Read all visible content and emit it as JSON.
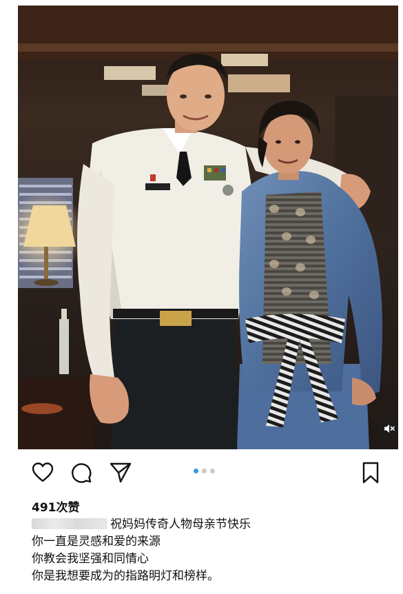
{
  "post": {
    "image_description_alt": "",
    "media_dots": {
      "count": 3,
      "active_index": 0
    },
    "audio": {
      "state": "muted",
      "icon": "speaker-muted-icon"
    }
  },
  "actions": {
    "like_icon": "heart-icon",
    "comment_icon": "comment-bubble-icon",
    "share_icon": "paper-plane-icon",
    "save_icon": "bookmark-icon"
  },
  "engagement": {
    "likes_text": "491次赞"
  },
  "caption": {
    "line1": "祝妈妈传奇人物母亲节快乐",
    "line2": "你一直是灵感和爱的来源",
    "line3": "你教会我坚强和同情心",
    "line4": "你是我想要成为的指路明灯和榜样。"
  },
  "colors": {
    "active_dot": "#3897f0",
    "inactive_dot": "#c9c9c9",
    "text": "#111111"
  }
}
